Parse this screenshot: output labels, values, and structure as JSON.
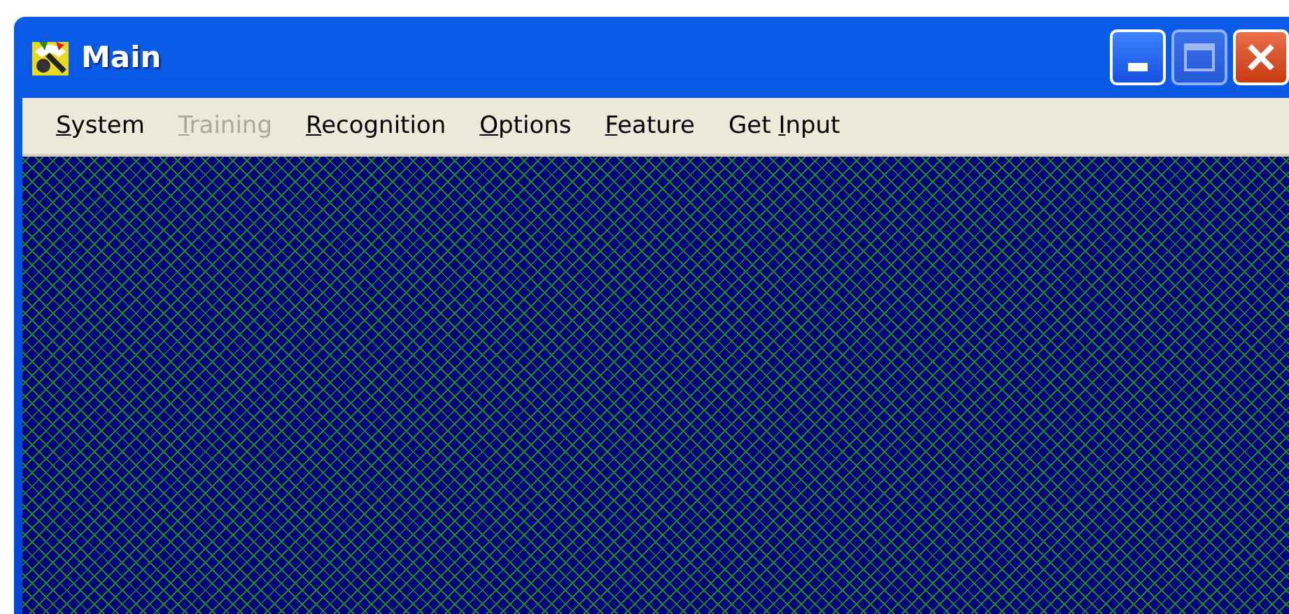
{
  "window": {
    "title": "Main",
    "buttons": [
      {
        "kind": "minimize",
        "disabled": false
      },
      {
        "kind": "maximize",
        "disabled": true
      },
      {
        "kind": "close",
        "disabled": false
      }
    ]
  },
  "menu": [
    {
      "key": "S",
      "after": "ystem",
      "disabled": false
    },
    {
      "key": "T",
      "after": "raining",
      "disabled": true
    },
    {
      "key": "R",
      "after": "ecognition",
      "disabled": false
    },
    {
      "key": "O",
      "after": "ptions",
      "disabled": false
    },
    {
      "key": "F",
      "after": "eature",
      "disabled": false
    },
    {
      "before": "Get ",
      "key": "I",
      "after": "nput",
      "disabled": false
    }
  ]
}
